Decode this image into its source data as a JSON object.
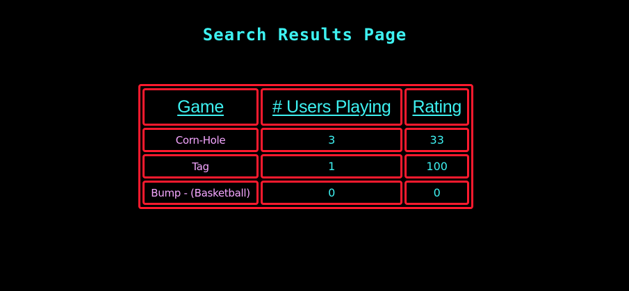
{
  "page": {
    "title": "Search Results Page"
  },
  "table": {
    "headers": {
      "game": "Game",
      "users_playing": "# Users Playing",
      "rating": "Rating"
    },
    "rows": [
      {
        "game": "Corn-Hole",
        "users_playing": "3",
        "rating": "33"
      },
      {
        "game": "Tag",
        "users_playing": "1",
        "rating": "100"
      },
      {
        "game": "Bump - (Basketball)",
        "users_playing": "0",
        "rating": "0"
      }
    ]
  },
  "colors": {
    "background": "#000000",
    "title": "#3ef2f2",
    "border": "#ff1a2e",
    "game_text": "#f5a6ff",
    "value_text": "#3ef2f2"
  }
}
